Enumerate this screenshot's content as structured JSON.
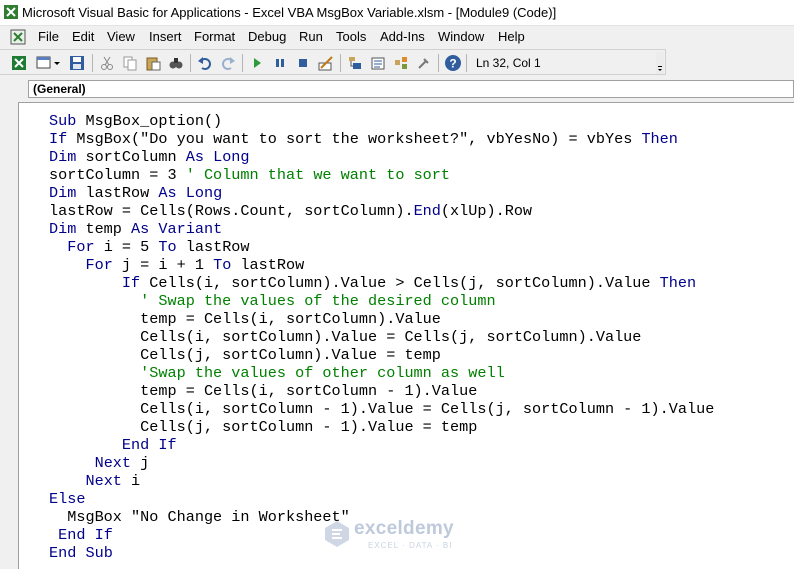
{
  "window": {
    "title": "Microsoft Visual Basic for Applications - Excel VBA MsgBox Variable.xlsm - [Module9 (Code)]"
  },
  "menu": {
    "items": [
      "File",
      "Edit",
      "View",
      "Insert",
      "Format",
      "Debug",
      "Run",
      "Tools",
      "Add-Ins",
      "Window",
      "Help"
    ]
  },
  "toolbar": {
    "status": "Ln 32, Col 1",
    "icons": [
      "excel-icon",
      "insert-module-icon",
      "save-icon",
      "cut-icon",
      "copy-icon",
      "paste-icon",
      "find-icon",
      "undo-icon",
      "redo-icon",
      "run-icon",
      "break-icon",
      "reset-icon",
      "design-mode-icon",
      "project-explorer-icon",
      "properties-icon",
      "object-browser-icon",
      "toolbox-icon",
      "help-icon"
    ]
  },
  "object_selector": {
    "value": "(General)"
  },
  "code": {
    "lines": [
      {
        "indent": "",
        "segments": [
          {
            "t": "Sub MsgBox_option()",
            "c": "kw-mixed"
          }
        ]
      },
      {
        "indent": "",
        "segments": []
      },
      {
        "indent": "",
        "segments": []
      },
      {
        "indent": "",
        "segments": []
      },
      {
        "indent": "",
        "segments": []
      },
      {
        "indent": "",
        "segments": []
      },
      {
        "indent": "",
        "segments": []
      },
      {
        "indent": "",
        "segments": []
      },
      {
        "indent": "",
        "segments": []
      },
      {
        "indent": "",
        "segments": []
      },
      {
        "indent": "",
        "segments": []
      },
      {
        "indent": "",
        "segments": []
      },
      {
        "indent": "",
        "segments": []
      },
      {
        "indent": "",
        "segments": []
      },
      {
        "indent": "",
        "segments": []
      },
      {
        "indent": "",
        "segments": []
      },
      {
        "indent": "",
        "segments": []
      },
      {
        "indent": "",
        "segments": []
      },
      {
        "indent": "",
        "segments": []
      },
      {
        "indent": "",
        "segments": []
      },
      {
        "indent": "",
        "segments": []
      },
      {
        "indent": "",
        "segments": []
      },
      {
        "indent": "",
        "segments": []
      },
      {
        "indent": "",
        "segments": []
      },
      {
        "indent": "",
        "segments": []
      }
    ],
    "text": [
      "Sub MsgBox_option()",
      "If MsgBox(\"Do you want to sort the worksheet?\", vbYesNo) = vbYes Then",
      "Dim sortColumn As Long",
      "sortColumn = 3 ' Column that we want to sort",
      "Dim lastRow As Long",
      "lastRow = Cells(Rows.Count, sortColumn).End(xlUp).Row",
      "Dim temp As Variant",
      "  For i = 5 To lastRow",
      "    For j = i + 1 To lastRow",
      "        If Cells(i, sortColumn).Value > Cells(j, sortColumn).Value Then",
      "          ' Swap the values of the desired column",
      "          temp = Cells(i, sortColumn).Value",
      "          Cells(i, sortColumn).Value = Cells(j, sortColumn).Value",
      "          Cells(j, sortColumn).Value = temp",
      "          'Swap the values of other column as well",
      "          temp = Cells(i, sortColumn - 1).Value",
      "          Cells(i, sortColumn - 1).Value = Cells(j, sortColumn - 1).Value",
      "          Cells(j, sortColumn - 1).Value = temp",
      "        End If",
      "     Next j",
      "    Next i",
      "Else",
      "  MsgBox \"No Change in Worksheet\"",
      " End If",
      "End Sub"
    ]
  },
  "watermark": {
    "name": "exceldemy",
    "tagline": "EXCEL · DATA · BI"
  },
  "colors": {
    "keyword": "#00008b",
    "comment": "#008000",
    "code_text": "#000000",
    "editor_bg": "#ffffff",
    "chrome_bg": "#f0f0f0"
  }
}
